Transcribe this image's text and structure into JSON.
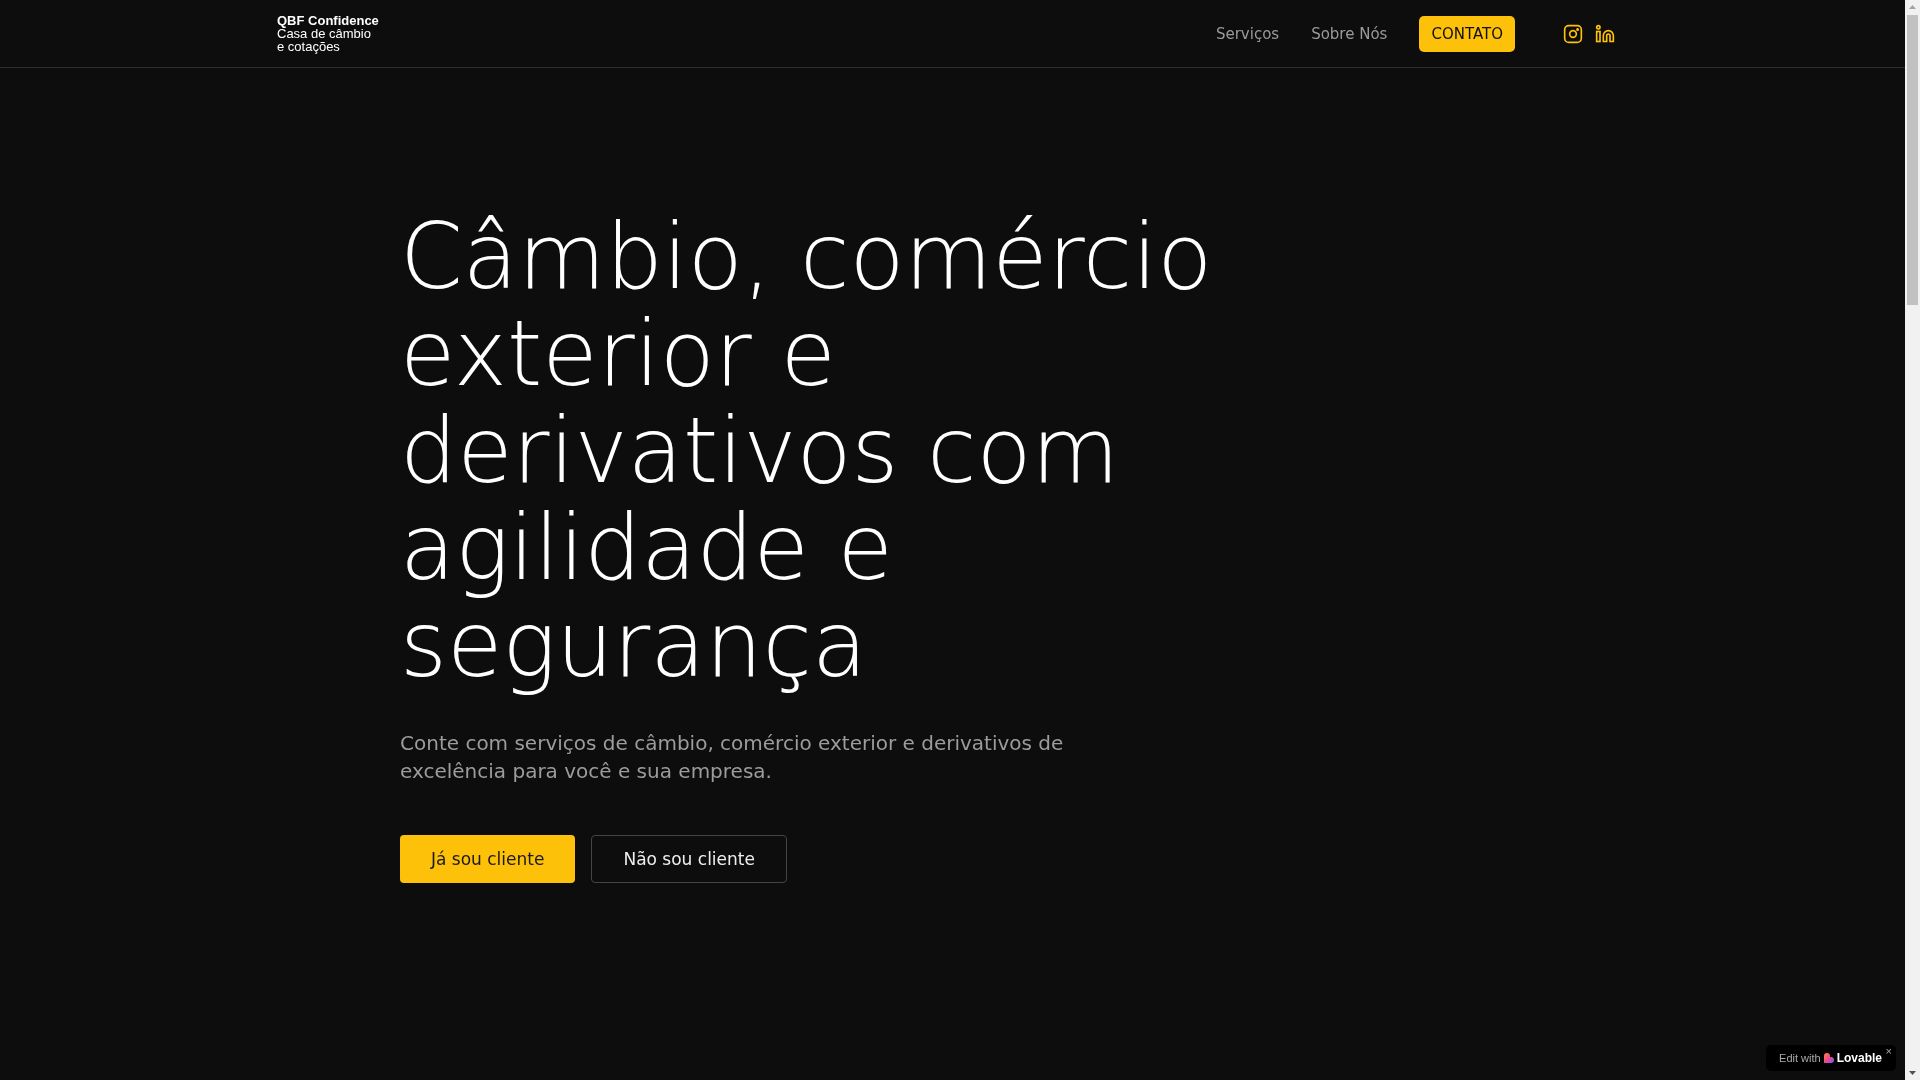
{
  "header": {
    "logo": {
      "name": "QBF Confidence",
      "tagline": [
        "Casa de câmbio",
        "e cotações"
      ]
    },
    "nav": [
      {
        "label": "Serviços",
        "kind": "link"
      },
      {
        "label": "Sobre Nós",
        "kind": "link"
      },
      {
        "label": "CONTATO",
        "kind": "button"
      }
    ],
    "social": [
      {
        "kind": "instagram"
      },
      {
        "kind": "linkedin"
      }
    ]
  },
  "hero": {
    "heading": "Câmbio, comércio exterior e derivativos com agilidade e segurança",
    "subtitle": "Conte com serviços de câmbio, comércio exterior e derivativos de excelência para você e sua empresa.",
    "buttons": [
      {
        "label": "Já sou cliente",
        "kind": "primary"
      },
      {
        "label": "Não sou cliente",
        "kind": "outline"
      }
    ]
  },
  "badge": {
    "prefix": "Edit with",
    "brand": "Lovable",
    "close": "×"
  }
}
